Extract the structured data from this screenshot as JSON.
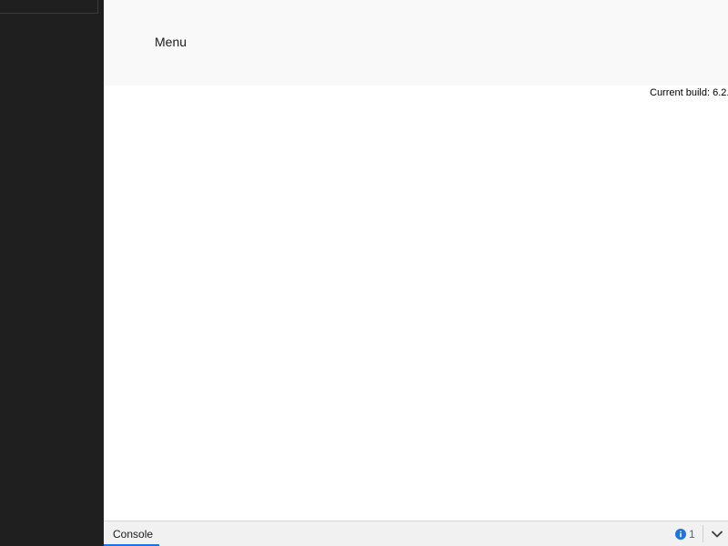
{
  "header": {
    "menu_label": "Menu",
    "build_label": "Current build: 6.2."
  },
  "bottom_bar": {
    "console_tab_label": "Console",
    "issue_count": "1",
    "icons": {
      "info": "info-icon",
      "chevron": "chevron-down-icon"
    }
  },
  "colors": {
    "left_panel": "#1f1f1f",
    "header_bg": "#f9f9f9",
    "tab_accent": "#1a73e8",
    "info_icon": "#1a73e8"
  }
}
